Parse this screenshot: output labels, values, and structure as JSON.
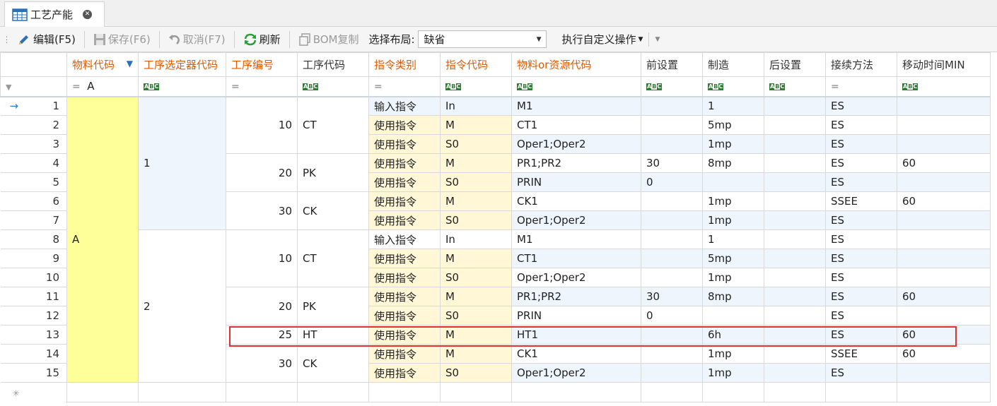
{
  "tab": {
    "title": "工艺产能",
    "icon": "grid-table-icon",
    "close_icon": "close-circle-icon"
  },
  "toolbar": {
    "edit": "编辑(F5)",
    "save": "保存(F6)",
    "cancel": "取消(F7)",
    "refresh": "刷新",
    "bom_copy": "BOM复制",
    "layout_label": "选择布局:",
    "layout_value": "缺省",
    "custom_ops": "执行自定义操作"
  },
  "columns": [
    {
      "label": "",
      "color": "normal"
    },
    {
      "label": "物料代码",
      "color": "orange",
      "filtered": true
    },
    {
      "label": "工序选定器代码",
      "color": "orange"
    },
    {
      "label": "工序编号",
      "color": "orange"
    },
    {
      "label": "工序代码",
      "color": "normal"
    },
    {
      "label": "指令类别",
      "color": "orange"
    },
    {
      "label": "指令代码",
      "color": "orange"
    },
    {
      "label": "物料or资源代码",
      "color": "orange"
    },
    {
      "label": "前设置",
      "color": "normal"
    },
    {
      "label": "制造",
      "color": "normal"
    },
    {
      "label": "后设置",
      "color": "normal"
    },
    {
      "label": "接续方法",
      "color": "normal"
    },
    {
      "label": "移动时间MIN",
      "color": "normal"
    }
  ],
  "filter_row": {
    "material_filter": "A",
    "equals_symbol": "=",
    "text_filter_icon": "abc-text-filter-icon"
  },
  "groups": {
    "material": "A",
    "selector_1": "1",
    "selector_2": "2",
    "ops": [
      {
        "no": "10",
        "code": "CT"
      },
      {
        "no": "20",
        "code": "PK"
      },
      {
        "no": "30",
        "code": "CK"
      },
      {
        "no": "10",
        "code": "CT"
      },
      {
        "no": "20",
        "code": "PK"
      },
      {
        "no": "25",
        "code": "HT"
      },
      {
        "no": "30",
        "code": "CK"
      }
    ]
  },
  "rows": [
    {
      "n": "1",
      "cat": "输入指令",
      "code": "In",
      "res": "M1",
      "pre": "",
      "mfg": "1",
      "post": "",
      "method": "ES",
      "move": ""
    },
    {
      "n": "2",
      "cat": "使用指令",
      "code": "M",
      "res": "CT1",
      "pre": "",
      "mfg": "5mp",
      "post": "",
      "method": "ES",
      "move": ""
    },
    {
      "n": "3",
      "cat": "使用指令",
      "code": "S0",
      "res": "Oper1;Oper2",
      "pre": "",
      "mfg": "1mp",
      "post": "",
      "method": "ES",
      "move": ""
    },
    {
      "n": "4",
      "cat": "使用指令",
      "code": "M",
      "res": "PR1;PR2",
      "pre": "30",
      "mfg": "8mp",
      "post": "",
      "method": "ES",
      "move": "60"
    },
    {
      "n": "5",
      "cat": "使用指令",
      "code": "S0",
      "res": "PRIN",
      "pre": "0",
      "mfg": "",
      "post": "",
      "method": "ES",
      "move": ""
    },
    {
      "n": "6",
      "cat": "使用指令",
      "code": "M",
      "res": "CK1",
      "pre": "",
      "mfg": "1mp",
      "post": "",
      "method": "SSEE",
      "move": "60"
    },
    {
      "n": "7",
      "cat": "使用指令",
      "code": "S0",
      "res": "Oper1;Oper2",
      "pre": "",
      "mfg": "1mp",
      "post": "",
      "method": "ES",
      "move": ""
    },
    {
      "n": "8",
      "cat": "输入指令",
      "code": "In",
      "res": "M1",
      "pre": "",
      "mfg": "1",
      "post": "",
      "method": "ES",
      "move": ""
    },
    {
      "n": "9",
      "cat": "使用指令",
      "code": "M",
      "res": "CT1",
      "pre": "",
      "mfg": "5mp",
      "post": "",
      "method": "ES",
      "move": ""
    },
    {
      "n": "10",
      "cat": "使用指令",
      "code": "S0",
      "res": "Oper1;Oper2",
      "pre": "",
      "mfg": "1mp",
      "post": "",
      "method": "ES",
      "move": ""
    },
    {
      "n": "11",
      "cat": "使用指令",
      "code": "M",
      "res": "PR1;PR2",
      "pre": "30",
      "mfg": "8mp",
      "post": "",
      "method": "ES",
      "move": "60"
    },
    {
      "n": "12",
      "cat": "使用指令",
      "code": "S0",
      "res": "PRIN",
      "pre": "0",
      "mfg": "",
      "post": "",
      "method": "ES",
      "move": ""
    },
    {
      "n": "13",
      "cat": "使用指令",
      "code": "M",
      "res": "HT1",
      "pre": "",
      "mfg": "6h",
      "post": "",
      "method": "ES",
      "move": "60"
    },
    {
      "n": "14",
      "cat": "使用指令",
      "code": "M",
      "res": "CK1",
      "pre": "",
      "mfg": "1mp",
      "post": "",
      "method": "SSEE",
      "move": "60"
    },
    {
      "n": "15",
      "cat": "使用指令",
      "code": "S0",
      "res": "Oper1;Oper2",
      "pre": "",
      "mfg": "1mp",
      "post": "",
      "method": "ES",
      "move": ""
    }
  ],
  "new_row_icon": "new-row-asterisk-icon",
  "current_row_icon": "current-row-arrow-icon",
  "colors": {
    "accent_orange": "#e05a00",
    "merged_material": "#ffff99",
    "instruction_cell": "#fff7d6",
    "alt_row": "#eef5fc",
    "highlight_box": "#e0312e"
  }
}
